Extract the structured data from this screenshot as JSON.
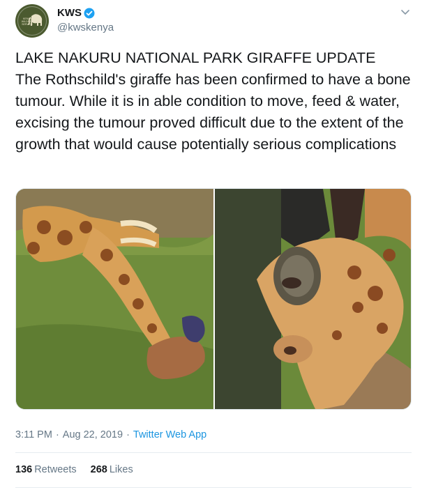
{
  "author": {
    "display_name": "KWS",
    "handle": "@kwskenya",
    "verified": true,
    "avatar_logo_text": "KENYA WILDLIFE SERVICE",
    "avatar_color": "#4b5a2f"
  },
  "tweet": {
    "headline": "LAKE NAKURU NATIONAL PARK GIRAFFE UPDATE",
    "text": "The Rothschild's giraffe has been confirmed to have a bone tumour. While it is in able condition to move, feed & water, excising the tumour proved difficult due to the extent of the growth that would cause potentially serious complications"
  },
  "media": [
    {
      "icon": "photo-giraffe-lying"
    },
    {
      "icon": "photo-giraffe-head-closeup"
    }
  ],
  "meta": {
    "time": "3:11 PM",
    "separator": "·",
    "date": "Aug 22, 2019",
    "source": "Twitter Web App"
  },
  "stats": {
    "retweets_count": "136",
    "retweets_label": "Retweets",
    "likes_count": "268",
    "likes_label": "Likes"
  },
  "colors": {
    "link": "#1b95e0",
    "secondary_text": "#657786",
    "primary_text": "#14171a",
    "verified_badge": "#1da1f2",
    "divider": "#e6ecf0"
  }
}
